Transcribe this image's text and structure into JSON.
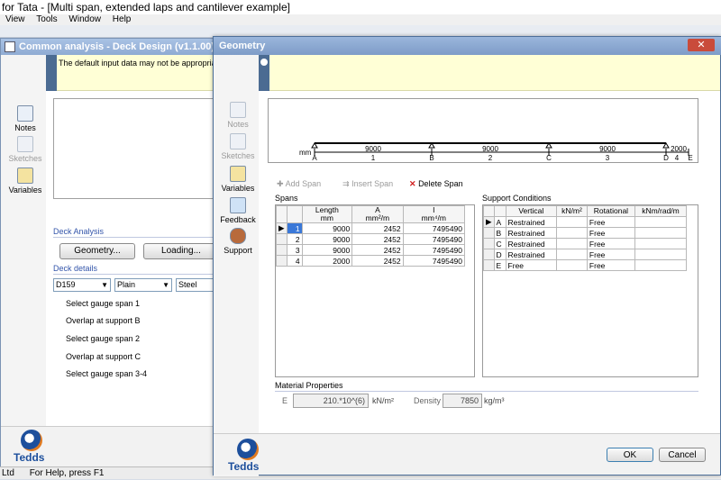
{
  "app": {
    "title": "for Tata - [Multi span, extended laps and cantilever example]",
    "menu": [
      "View",
      "Tools",
      "Window",
      "Help"
    ],
    "status_left": "Ltd",
    "status_text": "For Help, press F1"
  },
  "bg_window": {
    "title": "Common analysis - Deck Design (v1.1.00)",
    "banner_text": "The default input data may not be appropriat",
    "sidebar": [
      {
        "label": "Notes",
        "icon": "notes-icon"
      },
      {
        "label": "Sketches",
        "icon": "sketches-icon"
      },
      {
        "label": "Variables",
        "icon": "variables-icon"
      }
    ],
    "deck_analysis_label": "Deck Analysis",
    "geometry_button": "Geometry...",
    "loading_button": "Loading...",
    "deck_details_label": "Deck details",
    "combos": [
      "D159",
      "Plain",
      "Steel"
    ],
    "list_items": [
      "Select gauge span 1",
      "Overlap at support B",
      "Select gauge span 2",
      "Overlap at support C",
      "Select gauge span 3-4"
    ],
    "logo_text": "Tedds"
  },
  "dialog": {
    "title": "Geometry",
    "sidebar": [
      {
        "label": "Notes",
        "icon": "notes-icon"
      },
      {
        "label": "Sketches",
        "icon": "sketches-icon"
      },
      {
        "label": "Variables",
        "icon": "variables-icon"
      },
      {
        "label": "Feedback",
        "icon": "feedback-icon"
      },
      {
        "label": "Support",
        "icon": "support-icon"
      }
    ],
    "diagram": {
      "unit": "mm",
      "span_lengths": [
        "9000",
        "9000",
        "9000",
        "2000"
      ],
      "span_numbers": [
        "1",
        "2",
        "3",
        "4"
      ],
      "supports": [
        "A",
        "B",
        "C",
        "D",
        "E"
      ]
    },
    "toolbar": {
      "add": "Add Span",
      "insert": "Insert Span",
      "delete": "Delete Span"
    },
    "spans_label": "Spans",
    "spans_table": {
      "headers": [
        {
          "main": "Length",
          "unit": "mm"
        },
        {
          "main": "A",
          "unit": "mm²/m"
        },
        {
          "main": "I",
          "unit": "mm⁴/m"
        }
      ],
      "rows": [
        [
          "1",
          "9000",
          "2452",
          "7495490"
        ],
        [
          "2",
          "9000",
          "2452",
          "7495490"
        ],
        [
          "3",
          "9000",
          "2452",
          "7495490"
        ],
        [
          "4",
          "2000",
          "2452",
          "7495490"
        ]
      ]
    },
    "support_label": "Support Conditions",
    "support_table": {
      "headers": [
        "Vertical",
        "kN/m²",
        "Rotational",
        "kNm/rad/m"
      ],
      "rows": [
        [
          "A",
          "Restrained",
          "",
          "Free",
          ""
        ],
        [
          "B",
          "Restrained",
          "",
          "Free",
          ""
        ],
        [
          "C",
          "Restrained",
          "",
          "Free",
          ""
        ],
        [
          "D",
          "Restrained",
          "",
          "Free",
          ""
        ],
        [
          "E",
          "Free",
          "",
          "Free",
          ""
        ]
      ]
    },
    "material": {
      "label": "Material Properties",
      "e_label": "E",
      "e_value": "210.*10^(6)",
      "e_unit": "kN/m²",
      "density_label": "Density",
      "density_value": "7850",
      "density_unit": "kg/m³"
    },
    "ok_button": "OK",
    "cancel_button": "Cancel",
    "logo_text": "Tedds"
  }
}
